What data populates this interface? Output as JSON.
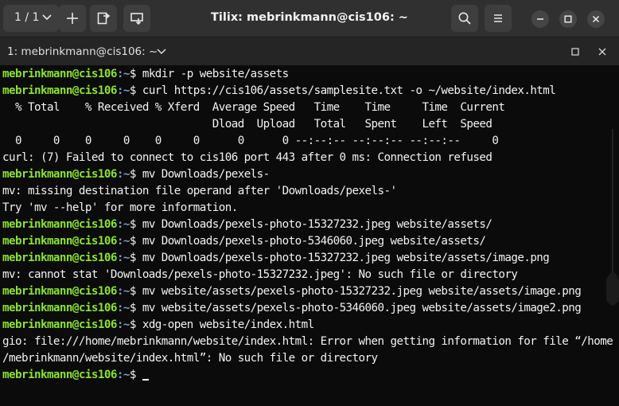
{
  "window": {
    "title": "Tilix: mebrinkmann@cis106: ~",
    "session_label": "1 / 1"
  },
  "terminal_tab": {
    "title": "1: mebrinkmann@cis106: ~"
  },
  "prompt": {
    "user_host": "mebrinkmann@cis106",
    "path": ":~",
    "symbol": "$ "
  },
  "lines": [
    {
      "type": "cmd",
      "text": "mkdir -p website/assets"
    },
    {
      "type": "cmd",
      "text": "curl https://cis106/assets/samplesite.txt -o ~/website/index.html"
    },
    {
      "type": "out",
      "text": "  % Total    % Received % Xferd  Average Speed   Time    Time     Time  Current"
    },
    {
      "type": "out",
      "text": "                                 Dload  Upload   Total   Spent    Left  Speed"
    },
    {
      "type": "out",
      "text": "  0     0    0     0    0     0      0      0 --:--:-- --:--:-- --:--:--     0"
    },
    {
      "type": "out",
      "text": "curl: (7) Failed to connect to cis106 port 443 after 0 ms: Connection refused"
    },
    {
      "type": "cmd",
      "text": "mv Downloads/pexels-"
    },
    {
      "type": "out",
      "text": "mv: missing destination file operand after 'Downloads/pexels-'"
    },
    {
      "type": "out",
      "text": "Try 'mv --help' for more information."
    },
    {
      "type": "cmd",
      "text": "mv Downloads/pexels-photo-15327232.jpeg website/assets/"
    },
    {
      "type": "cmd",
      "text": "mv Downloads/pexels-photo-5346060.jpeg website/assets/"
    },
    {
      "type": "cmd",
      "text": "mv Downloads/pexels-photo-15327232.jpeg website/assets/image.png"
    },
    {
      "type": "out",
      "text": "mv: cannot stat 'Downloads/pexels-photo-15327232.jpeg': No such file or directory"
    },
    {
      "type": "cmd",
      "text": "mv website/assets/pexels-photo-15327232.jpeg website/assets/image.png"
    },
    {
      "type": "cmd",
      "text": "mv website/assets/pexels-photo-5346060.jpeg website/assets/image2.png"
    },
    {
      "type": "cmd",
      "text": "xdg-open website/index.html"
    },
    {
      "type": "out",
      "text": "gio: file:///home/mebrinkmann/website/index.html: Error when getting information for file “/home"
    },
    {
      "type": "out",
      "text": "/mebrinkmann/website/index.html”: No such file or directory"
    },
    {
      "type": "cmd",
      "text": ""
    }
  ],
  "colors": {
    "user_host": "#8ae234",
    "path": "#729fcf",
    "text": "#f2f2f2",
    "background": "#0b0b0b"
  },
  "icons": {
    "session_chevron": "chevron-down-icon",
    "add_terminal": "plus-icon",
    "split_right": "split-right-icon",
    "split_down": "split-down-icon",
    "search": "search-icon",
    "menu": "hamburger-menu-icon",
    "minimize": "minimize-icon",
    "maximize": "maximize-icon",
    "close": "close-icon"
  }
}
